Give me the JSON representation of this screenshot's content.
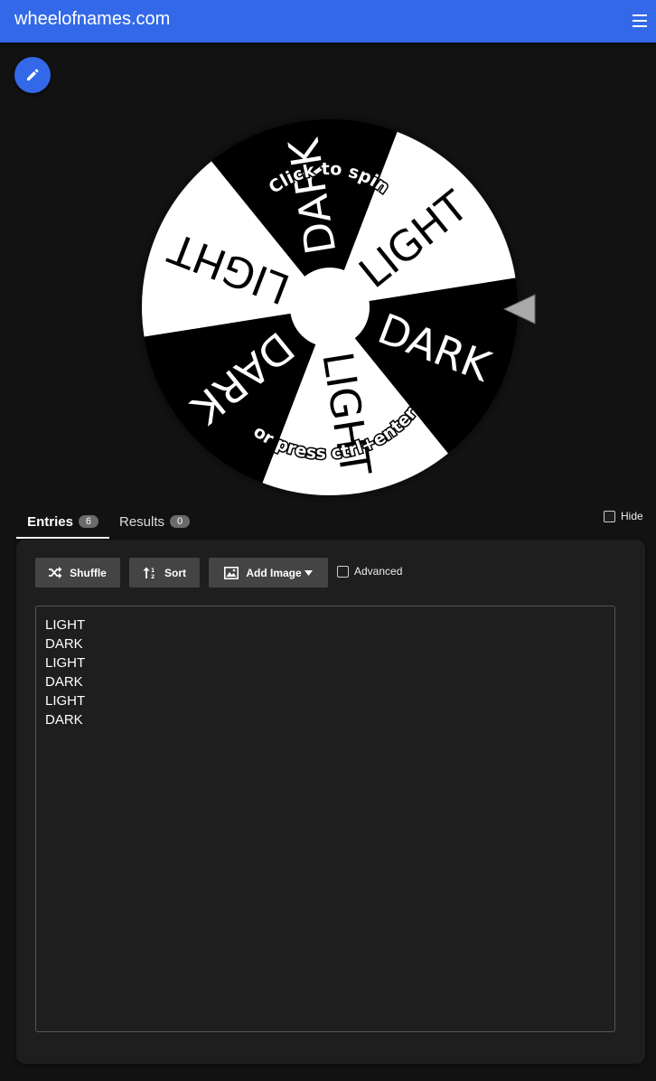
{
  "app": {
    "brand": "wheelofnames.com"
  },
  "wheel": {
    "segments": [
      "LIGHT",
      "DARK",
      "LIGHT",
      "DARK",
      "LIGHT",
      "DARK"
    ],
    "hint_top": "Click to spin",
    "hint_bottom": "or press ctrl+enter",
    "colors": {
      "light": "#ffffff",
      "dark": "#000000"
    }
  },
  "tabs": [
    {
      "label": "Entries",
      "count": "6"
    },
    {
      "label": "Results",
      "count": "0"
    }
  ],
  "hide_label": "Hide",
  "toolbar": {
    "shuffle_label": "Shuffle",
    "sort_label": "Sort",
    "add_image_label": "Add Image",
    "advanced_label": "Advanced"
  },
  "entries": [
    "LIGHT",
    "DARK",
    "LIGHT",
    "DARK",
    "LIGHT",
    "DARK"
  ],
  "colors": {
    "accent": "#3369e8",
    "background": "#121212",
    "panel": "#1e1e1e",
    "button": "#444444"
  }
}
